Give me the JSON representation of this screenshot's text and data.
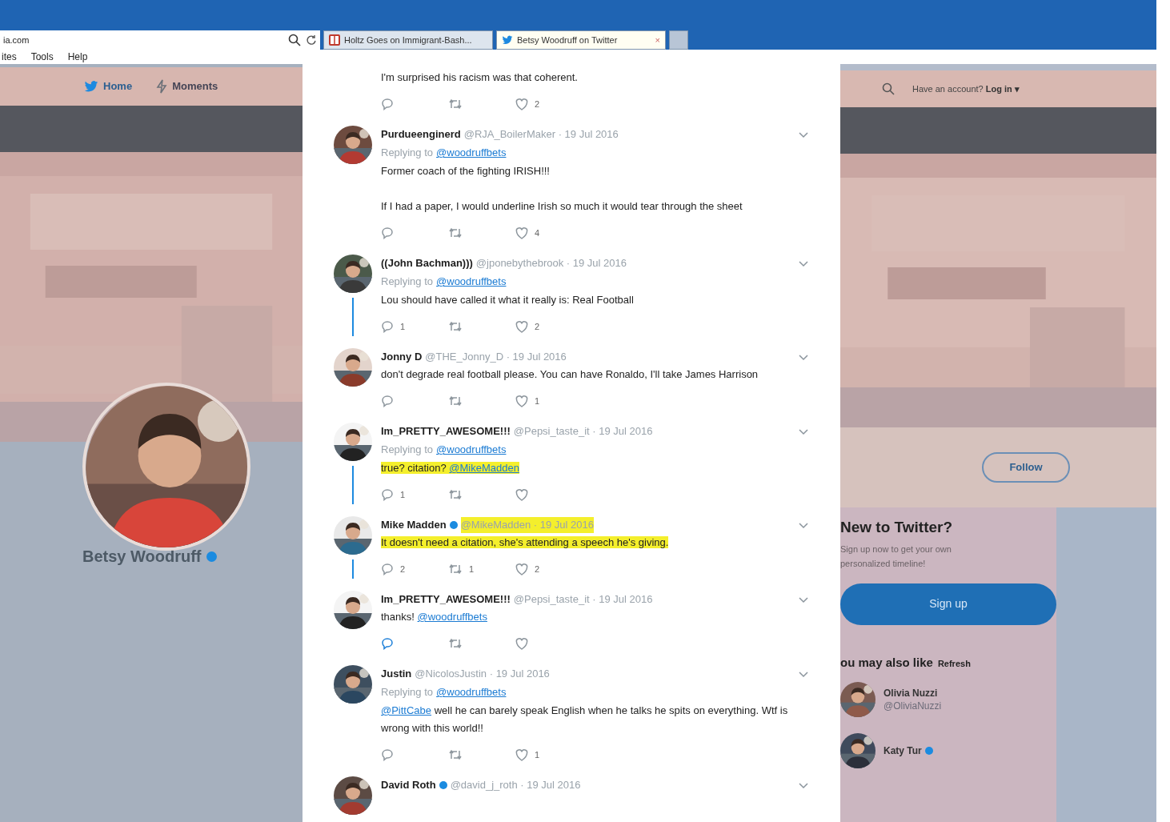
{
  "browser": {
    "address": "ia.com",
    "tabs": [
      {
        "label": "Holtz Goes on Immigrant-Bash...",
        "selected": false
      },
      {
        "label": "Betsy Woodruff on Twitter",
        "selected": true,
        "close": "×"
      }
    ],
    "menu": [
      "ites",
      "Tools",
      "Help"
    ]
  },
  "left_panel": {
    "nav": [
      {
        "label": "Home",
        "selected": true
      },
      {
        "label": "Moments",
        "selected": false
      }
    ],
    "profile": {
      "name": "Betsy Woodruff",
      "verified": true
    }
  },
  "timeline": [
    {
      "text": [
        {
          "kind": "text",
          "text": "I'm surprised his racism was that coherent."
        }
      ],
      "likes": "2"
    },
    {
      "name": "Purdueenginerd",
      "handle": "@RJA_BoilerMaker",
      "date": "· 19 Jul 2016",
      "replying_label": "Replying to",
      "replying_to": "@woodruffbets",
      "text": [
        {
          "kind": "text",
          "text": "Former coach of the fighting IRISH!!!\n\nIf I had a paper, I would underline Irish so much it would tear through the sheet"
        }
      ],
      "likes": "4"
    },
    {
      "name": "((John Bachman)))",
      "handle": "@jponebythebrook",
      "date": "· 19 Jul 2016",
      "replying_label": "Replying to",
      "replying_to": "@woodruffbets",
      "text": [
        {
          "kind": "text",
          "text": "Lou should have called it what it really is: Real Football"
        }
      ],
      "thread": true,
      "replies": "1",
      "likes": "2"
    },
    {
      "name": "Jonny D",
      "handle": "@THE_Jonny_D",
      "date": "· 19 Jul 2016",
      "text": [
        {
          "kind": "text",
          "text": "don't degrade real football please.  You can have Ronaldo, I'll take James Harrison"
        }
      ],
      "likes": "1"
    },
    {
      "name": "Im_PRETTY_AWESOME!!!",
      "handle": "@Pepsi_taste_it",
      "date": "· 19 Jul 2016",
      "replying_label": "Replying to",
      "replying_to": "@woodruffbets",
      "text": [
        {
          "kind": "text",
          "text": "true? citation? "
        },
        {
          "kind": "mention",
          "text": "@MikeMadden"
        }
      ],
      "highlighted": true,
      "thread": true,
      "replies": "1"
    },
    {
      "name": "Mike Madden",
      "handle": "@MikeMadden",
      "date": "· 19 Jul 2016",
      "text": [
        {
          "kind": "text",
          "text": "It doesn't need a citation, she's attending a speech he's giving."
        }
      ],
      "highlighted": true,
      "header_highlighted": true,
      "verified": true,
      "thread": true,
      "replies": "2",
      "retweets": "1",
      "likes": "2"
    },
    {
      "name": "Im_PRETTY_AWESOME!!!",
      "handle": "@Pepsi_taste_it",
      "date": "· 19 Jul 2016",
      "text": [
        {
          "kind": "text",
          "text": "thanks! "
        },
        {
          "kind": "mention",
          "text": "@woodruffbets"
        }
      ],
      "reply_active": true
    },
    {
      "name": "Justin",
      "handle": "@NicolosJustin",
      "date": "· 19 Jul 2016",
      "replying_label": "Replying to",
      "replying_to": "@woodruffbets",
      "text": [
        {
          "kind": "mention",
          "text": "@PittCabe"
        },
        {
          "kind": "text",
          "text": " well he can barely speak English when he talks he spits on everything. Wtf is wrong with this world!!"
        }
      ],
      "likes": "1"
    },
    {
      "name": "David Roth",
      "handle": "@david_j_roth",
      "date": "· 19 Jul 2016",
      "verified": true
    }
  ],
  "right_panel": {
    "login_prompt": "Have an account?",
    "login_link": "Log in ▾",
    "follow": "Follow",
    "signup_card": {
      "title": "New to Twitter?",
      "text": "Sign up now to get your own personalized timeline!",
      "button": "Sign up"
    },
    "suggestions": {
      "title": "ou may also like",
      "refresh": "Refresh",
      "people": [
        {
          "name": "Olivia Nuzzi",
          "handle": "@OliviaNuzzi"
        },
        {
          "name": "Katy Tur",
          "verified": true
        }
      ]
    }
  }
}
